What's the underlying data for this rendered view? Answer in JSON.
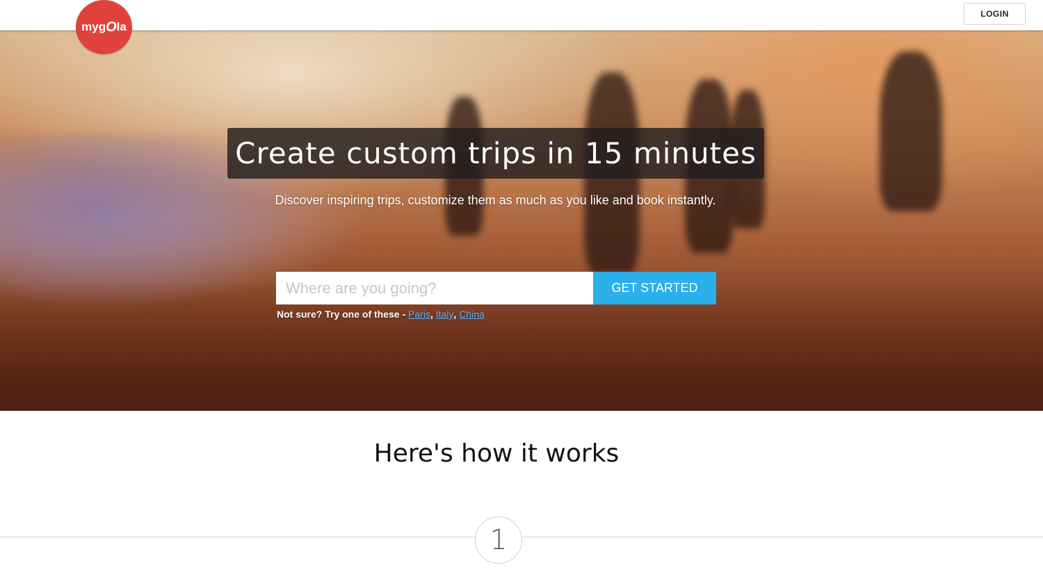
{
  "header": {
    "logo_text_pre": "myg",
    "logo_text_o": "O",
    "logo_text_post": "la",
    "login_label": "LOGIN"
  },
  "hero": {
    "headline": "Create custom trips in 15 minutes",
    "subline": "Discover inspiring trips, customize them as much as you like and book instantly.",
    "search_placeholder": "Where are you going?",
    "cta_label": "GET STARTED",
    "suggest_prefix": "Not sure? Try one of these - ",
    "suggestions": [
      "Paris",
      "Italy",
      "China"
    ]
  },
  "how": {
    "title": "Here's how it works",
    "step_number": "1"
  },
  "colors": {
    "brand_red": "#e0423b",
    "cta_blue": "#2ab0ea",
    "link_blue": "#5fb3ff"
  }
}
